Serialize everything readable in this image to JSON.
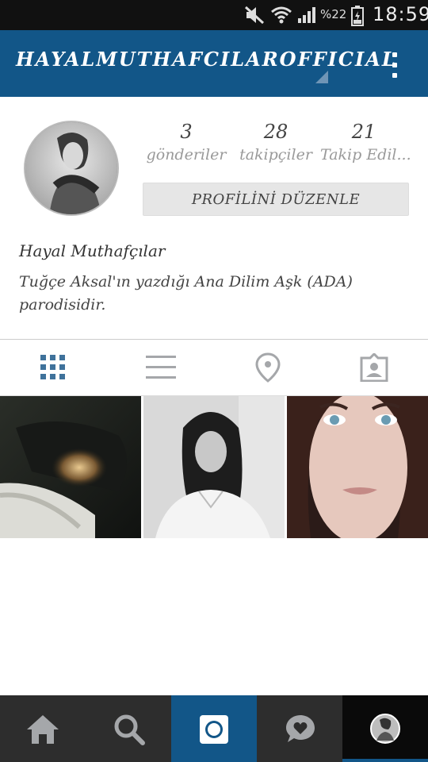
{
  "status_bar": {
    "battery_percent": "%22",
    "clock": "18:59",
    "icons": [
      "mute-icon",
      "wifi-icon",
      "signal-icon",
      "battery-icon"
    ]
  },
  "header": {
    "username": "HAYALMUTHAFCILAROFFICIAL",
    "background_color": "#125688",
    "menu_icon": "overflow-menu-icon"
  },
  "profile": {
    "stats": [
      {
        "value": "3",
        "label": "gönderiler"
      },
      {
        "value": "28",
        "label": "takipçiler"
      },
      {
        "value": "21",
        "label": "Takip Edil..."
      }
    ],
    "edit_profile_label": "PROFİLİNİ DÜZENLE",
    "full_name": "Hayal Muthafçılar",
    "bio": "Tuğçe Aksal'ın yazdığı Ana Dilim Aşk (ADA) parodisidir."
  },
  "tabs": [
    {
      "name": "grid-view-icon",
      "active": true
    },
    {
      "name": "list-view-icon",
      "active": false
    },
    {
      "name": "location-pin-icon",
      "active": false
    },
    {
      "name": "tagged-photos-icon",
      "active": false
    }
  ],
  "posts": [
    "post-1",
    "post-2",
    "post-3"
  ],
  "bottom_nav": [
    {
      "name": "home-icon",
      "active": false
    },
    {
      "name": "search-icon",
      "active": false
    },
    {
      "name": "camera-icon",
      "active": false
    },
    {
      "name": "activity-heart-icon",
      "active": false
    },
    {
      "name": "profile-avatar-icon",
      "active": true
    }
  ],
  "colors": {
    "accent": "#125688",
    "active_tab": "#3f729b",
    "inactive_tab": "#a5a7aa"
  }
}
